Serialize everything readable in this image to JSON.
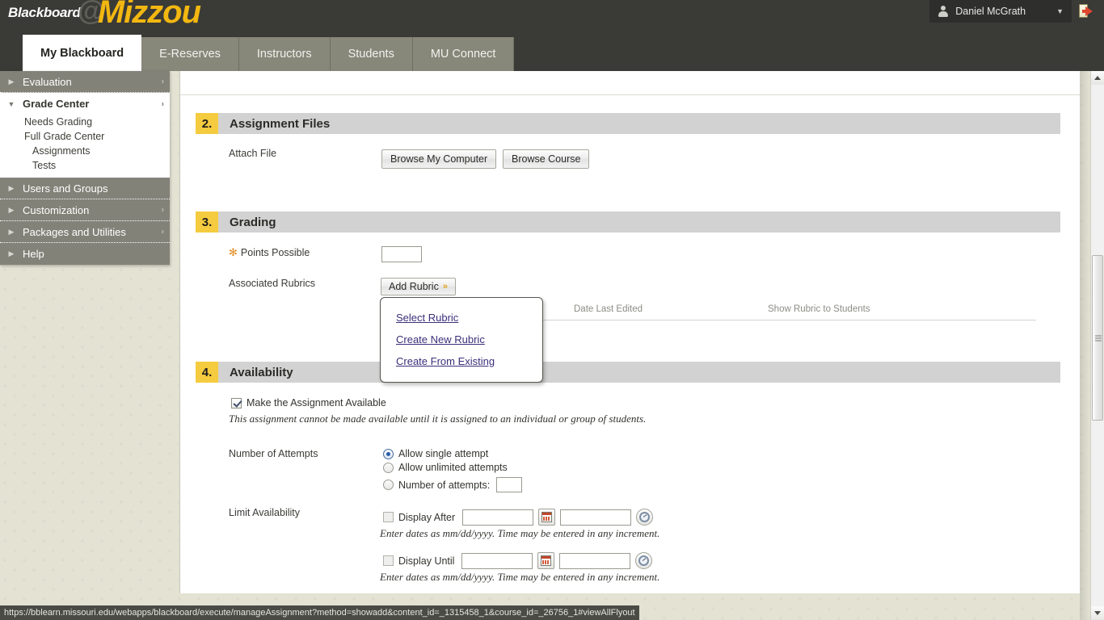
{
  "header": {
    "brand_primary": "Blackboard",
    "brand_at": "@",
    "brand_secondary": "Mizzou",
    "user_name": "Daniel McGrath",
    "user_caret": "▼",
    "logout_title": "Logout"
  },
  "tabs": [
    {
      "label": "My Blackboard",
      "active": true
    },
    {
      "label": "E-Reserves",
      "active": false
    },
    {
      "label": "Instructors",
      "active": false
    },
    {
      "label": "Students",
      "active": false
    },
    {
      "label": "MU Connect",
      "active": false
    }
  ],
  "course_menu": [
    {
      "label": "Evaluation",
      "type": "collapsed"
    },
    {
      "label": "Grade Center",
      "type": "expanded"
    },
    {
      "label": "Needs Grading",
      "type": "sub"
    },
    {
      "label": "Full Grade Center",
      "type": "sub"
    },
    {
      "label": "Assignments",
      "type": "sub2"
    },
    {
      "label": "Tests",
      "type": "sub2"
    },
    {
      "label": "Users and Groups",
      "type": "collapsed-nochev"
    },
    {
      "label": "Customization",
      "type": "collapsed"
    },
    {
      "label": "Packages and Utilities",
      "type": "collapsed"
    },
    {
      "label": "Help",
      "type": "collapsed-nochev"
    }
  ],
  "sections": {
    "assignment_files": {
      "number": "2.",
      "title": "Assignment Files",
      "attach_label": "Attach File",
      "browse_computer": "Browse My Computer",
      "browse_course": "Browse Course"
    },
    "grading": {
      "number": "3.",
      "title": "Grading",
      "points_label": "Points Possible",
      "points_value": "",
      "required_marker": "✻",
      "rubrics_label": "Associated Rubrics",
      "add_rubric_button": "Add Rubric",
      "add_rubric_caret": "»",
      "menu_items": [
        "Select Rubric",
        "Create New Rubric",
        "Create From Existing"
      ],
      "table_headers": [
        "Date Last Edited",
        "Show Rubric to Students"
      ]
    },
    "availability": {
      "number": "4.",
      "title": "Availability",
      "make_available_label": "Make the Assignment Available",
      "make_available_checked": true,
      "availability_note": "This assignment cannot be made available until it is assigned to an individual or group of students.",
      "attempts_label": "Number of Attempts",
      "attempts_options": [
        {
          "label": "Allow single attempt",
          "selected": true
        },
        {
          "label": "Allow unlimited attempts",
          "selected": false
        },
        {
          "label": "Number of attempts:",
          "selected": false,
          "has_input": true,
          "value": ""
        }
      ],
      "limit_label": "Limit Availability",
      "display_after_label": "Display After",
      "display_after_date": "",
      "display_after_time": "",
      "display_until_label": "Display Until",
      "display_until_date": "",
      "display_until_time": "",
      "date_note": "Enter dates as mm/dd/yyyy. Time may be entered in any increment."
    }
  },
  "status_bar": {
    "url": "https://bblearn.missouri.edu/webapps/blackboard/execute/manageAssignment?method=showadd&content_id=_1315458_1&course_id=_26756_1#viewAllFlyout"
  },
  "colors": {
    "brand_yellow": "#f2b711",
    "section_number_bg": "#f5cb3f",
    "section_header_bg": "#d2d2d2",
    "header_dark": "#3a3a37",
    "tab_inactive": "#87877a",
    "menu_item_bg": "#828279",
    "link_color": "#3b2f7a"
  }
}
